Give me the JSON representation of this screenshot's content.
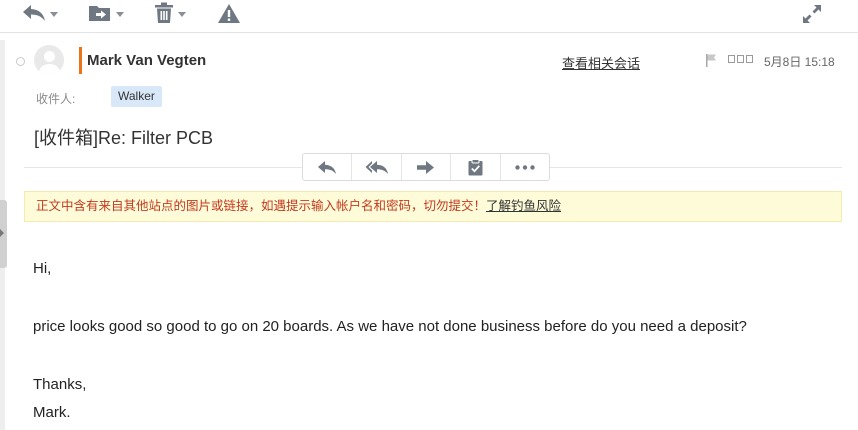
{
  "toolbar": {
    "icons": [
      "reply-icon",
      "move-icon",
      "delete-icon",
      "report-icon",
      "expand-icon"
    ]
  },
  "sender": {
    "name": "Mark Van Vegten",
    "view_conversation": "查看相关会话",
    "flag_boxes": "□□□",
    "date": "5月8日 15:18"
  },
  "recipients": {
    "label": "收件人:",
    "chips": [
      "Walker"
    ]
  },
  "subject": "[收件箱]Re: Filter PCB",
  "actions": [
    "reply-icon",
    "reply-all-icon",
    "forward-icon",
    "clipboard-icon",
    "more-icon"
  ],
  "warning": {
    "text": "正文中含有来自其他站点的图片或链接，如遇提示输入帐户名和密码，切勿提交！",
    "link": "了解钓鱼风险",
    "colors": {
      "background": "#fefbd8",
      "text": "#c33a1f"
    }
  },
  "body": {
    "lines": [
      "Hi,",
      "price looks good so good to go on 20 boards. As we have not done business before do you need a deposit?",
      "Thanks,",
      "Mark."
    ]
  },
  "colors": {
    "accent_bar": "#e8751a",
    "recipient_chip": "#d8e8f9"
  }
}
